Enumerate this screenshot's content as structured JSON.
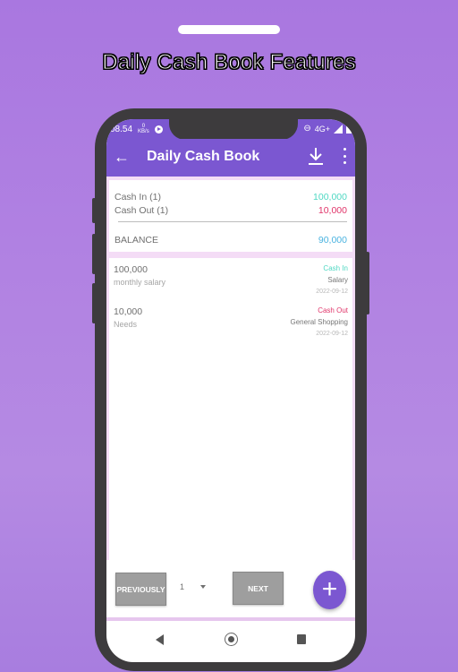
{
  "promo": {
    "title": "Daily Cash Book Features"
  },
  "status_bar": {
    "time": "08.54",
    "speed_value": "0",
    "speed_unit": "KB/s",
    "network": "4G+"
  },
  "app_bar": {
    "title": "Daily Cash Book",
    "back_icon": "arrow-left",
    "download_icon": "download",
    "more_icon": "more-vertical"
  },
  "summary": {
    "cash_in_label": "Cash In (1)",
    "cash_in_value": "100,000",
    "cash_out_label": "Cash Out (1)",
    "cash_out_value": "10,000",
    "balance_label": "BALANCE",
    "balance_value": "90,000"
  },
  "transactions": [
    {
      "amount": "100,000",
      "note": "monthly salary",
      "type": "Cash In",
      "category": "Salary",
      "date": "2022-09-12"
    },
    {
      "amount": "10,000",
      "note": "Needs",
      "type": "Cash Out",
      "category": "General Shopping",
      "date": "2022-09-12"
    }
  ],
  "pagination": {
    "previous_label": "PREVIOUSLY",
    "page": "1",
    "next_label": "NEXT"
  },
  "fab": {
    "label": "+"
  },
  "colors": {
    "primary": "#7b57d1",
    "cash_in": "#4fd8c3",
    "cash_out": "#e0356a",
    "balance": "#4ab3e0"
  }
}
